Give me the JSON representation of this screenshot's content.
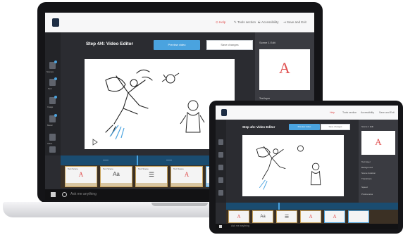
{
  "app": {
    "nav": [
      "Help",
      "Tools section",
      "Accessibility",
      "Save and Exit"
    ],
    "step_title": "Step 4/4: Video Editor",
    "preview_button": "Preview video",
    "save_button": "Save changes",
    "panel_label": "Scene 1 Edit",
    "panel_items": [
      "Text layer",
      "Background",
      "Scene duration",
      "Transitions",
      "Speed",
      "Preferences"
    ],
    "thumb_letter": "A",
    "sidebar_items": [
      "Scenes",
      "Text",
      "Image",
      "Music",
      "Voice",
      "Backgrounds"
    ],
    "timeline_track": "Scene 1",
    "cards": [
      {
        "title": "Text Scene",
        "icon": "A",
        "foot": "Keyword"
      },
      {
        "title": "Text Scene",
        "icon": "Aa",
        "foot": "Keyword"
      },
      {
        "title": "Text Scene",
        "icon": "list",
        "foot": "Keyword"
      },
      {
        "title": "Text Scene",
        "icon": "A",
        "foot": "Keyword"
      },
      {
        "title": "Text Scene",
        "icon": "A",
        "foot": "Keyword"
      }
    ]
  },
  "taskbar": {
    "search_placeholder": "Ask me anything"
  },
  "colors": {
    "accent": "#4aa3df",
    "nav_highlight": "#e04e4e",
    "dark_bg": "#2b2c31",
    "card_border": "#c8a35d"
  }
}
